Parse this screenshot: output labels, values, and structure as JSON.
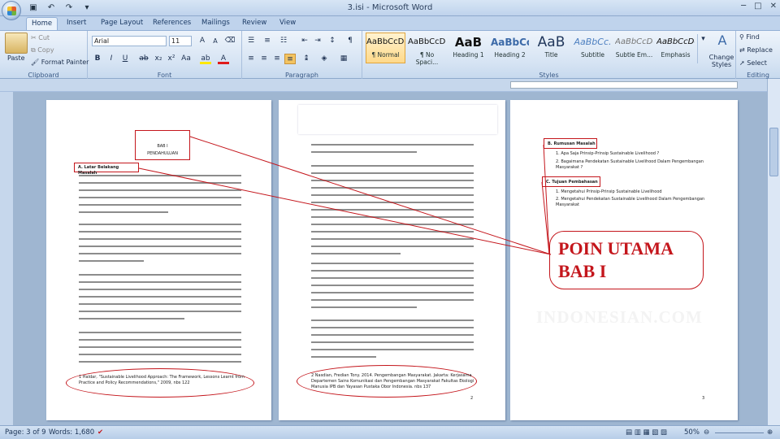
{
  "window": {
    "title": "3.isi - Microsoft Word"
  },
  "tabs": [
    "Home",
    "Insert",
    "Page Layout",
    "References",
    "Mailings",
    "Review",
    "View"
  ],
  "clipboard": {
    "paste": "Paste",
    "cut": "Cut",
    "copy": "Copy",
    "format_painter": "Format Painter",
    "label": "Clipboard"
  },
  "font": {
    "name": "Arial",
    "size": "11",
    "label": "Font"
  },
  "paragraph": {
    "label": "Paragraph"
  },
  "styles": {
    "label": "Styles",
    "items": [
      {
        "preview": "AaBbCcDc",
        "name": "¶ Normal"
      },
      {
        "preview": "AaBbCcDc",
        "name": "¶ No Spaci..."
      },
      {
        "preview": "AaB",
        "name": "Heading 1"
      },
      {
        "preview": "AaBbCc",
        "name": "Heading 2"
      },
      {
        "preview": "AaB",
        "name": "Title"
      },
      {
        "preview": "AaBbCc.",
        "name": "Subtitle"
      },
      {
        "preview": "AaBbCcDc",
        "name": "Subtle Em..."
      },
      {
        "preview": "AaBbCcDc",
        "name": "Emphasis"
      }
    ],
    "change_styles": "Change Styles"
  },
  "editing": {
    "find": "Find",
    "replace": "Replace",
    "select": "Select",
    "label": "Editing"
  },
  "page1": {
    "bab": "BAB I",
    "heading": "PENDAHULUAN",
    "section": "A.  Latar Belakang  Masalah",
    "footnote": "1 Haldar, \"Sustainable Livelihood Approach: The Framework, Lessons Learnt from Practice and Policy Recommendations,\" 2009, nbs 122"
  },
  "page2": {
    "footnote": "2 Nasdian, Fredian Tony. 2014. Pengembangan Masyarakat. Jakarta: Kerjasama Departemen Sains Komunikasi dan Pengembangan Masyarakat Fakultas Ekologi Manusia IPB dan Yayasan Pustaka Obor Indonesia. nbs 137",
    "page_no": "2"
  },
  "page3": {
    "rumusan": "B.  Rumusan Masalah",
    "tujuan": "C.  Tujuan Pembahasan",
    "r1": "1.  Apa Saja Prinsip-Prinsip Sustainable Livelihood ?",
    "r2": "2.  Bagaimana Pendekatan Sustainable Livelihood Dalam Pengembangan Masyarakat ?",
    "t1": "1.  Mengetahui Prinsip-Prinsip Sustainable Livelihood",
    "t2": "2.  Mengetahui Pendekatan Sustainable Livelihood Dalam Pengembangan Masyarakat",
    "page_no": "3"
  },
  "callout": {
    "line1": "POIN UTAMA",
    "line2": "BAB I"
  },
  "watermark": "INDONESIAN.COM",
  "status": {
    "page": "Page: 3 of 9",
    "words": "Words: 1,680",
    "zoom": "50%"
  }
}
